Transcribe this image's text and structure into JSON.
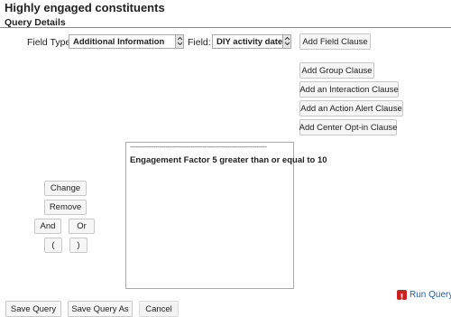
{
  "header": {
    "title": "Highly engaged constituents",
    "section": "Query Details"
  },
  "field_row": {
    "field_type_label": "Field Type:",
    "field_type_value": "Additional Information",
    "field_label": "Field:",
    "field_value": "DIY activity date",
    "add_field_clause": "Add Field Clause"
  },
  "clause_buttons": {
    "add_group_clause": "Add Group Clause",
    "add_interaction_clause": "Add an Interaction Clause",
    "add_action_alert_clause": "Add an Action Alert Clause",
    "add_center_optin_clause": "Add Center Opt-in Clause"
  },
  "editor_buttons": {
    "change": "Change",
    "remove": "Remove",
    "and": "And",
    "or": "Or",
    "open_paren": "(",
    "close_paren": ")"
  },
  "query_box": {
    "dashes": "----------------------------------------------------------------------",
    "clause": "Engagement Factor 5 greater than or equal to 10"
  },
  "footer": {
    "save_query": "Save Query",
    "save_query_as": "Save Query As",
    "cancel": "Cancel",
    "run_query": "Run Query"
  },
  "colors": {
    "link": "#1a5fa8",
    "run_icon": "#cc2222"
  },
  "icons": {
    "run": "run-query-icon",
    "dropdown": "chevron-down-icon"
  }
}
